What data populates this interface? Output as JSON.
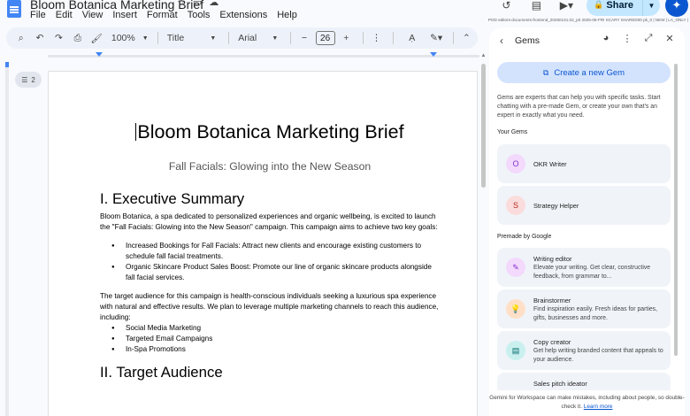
{
  "app": {
    "doc_title": "Bloom Botanica Marketing Brief",
    "menus": [
      "File",
      "Edit",
      "View",
      "Insert",
      "Format",
      "Tools",
      "Extensions",
      "Help"
    ],
    "share_label": "Share",
    "build_note": "POD editors-documents-frontend_20250131.02_p0 2025-05-FRI SCARY SHARED00 pk_0 | NEW | LA_ONLY |"
  },
  "toolbar": {
    "zoom": "100%",
    "style": "Title",
    "font": "Arial",
    "font_size": "26"
  },
  "outline": {
    "count": "2"
  },
  "document": {
    "title": "Bloom Botanica Marketing Brief",
    "subtitle": "Fall Facials: Glowing into the New Season",
    "heading1": "I. Executive Summary",
    "intro": "Bloom Botanica, a spa dedicated to personalized experiences and organic wellbeing, is excited to launch the \"Fall Facials: Glowing into the New Season\" campaign. This campaign aims to achieve two key goals:",
    "goals": [
      "Increased Bookings for Fall Facials: Attract new clients and encourage existing customers to schedule fall facial treatments.",
      "Organic Skincare Product Sales Boost:  Promote our line of organic skincare products alongside fall facial services."
    ],
    "audience_para": "The target audience for this campaign is health-conscious individuals seeking a luxurious spa experience with natural and effective results. We plan to leverage multiple marketing channels to reach this audience, including:",
    "channels": [
      "Social Media Marketing",
      "Targeted Email Campaigns",
      "In-Spa Promotions"
    ],
    "heading2": "II. Target Audience"
  },
  "gems_panel": {
    "title": "Gems",
    "create_label": "Create a new Gem",
    "description": "Gems are experts that can help you with specific tasks. Start chatting with a pre-made Gem, or create your own that's an expert in exactly what you need.",
    "your_gems_label": "Your Gems",
    "your_gems": [
      {
        "initial": "O",
        "name": "OKR Writer"
      },
      {
        "initial": "S",
        "name": "Strategy Helper"
      }
    ],
    "premade_label": "Premade by Google",
    "premade": [
      {
        "name": "Writing editor",
        "desc": "Elevate your writing. Get clear, constructive feedback, from grammar to..."
      },
      {
        "name": "Brainstormer",
        "desc": "Find inspiration easily. Fresh ideas for parties, gifts, businesses and more."
      },
      {
        "name": "Copy creator",
        "desc": "Get help writing branded content that appeals to your audience."
      },
      {
        "name": "Sales pitch ideator",
        "desc": ""
      }
    ],
    "footer_text": "Gemini for Workspace can make mistakes, including about people, so double-check it.",
    "footer_link": "Learn more"
  },
  "colors": {
    "accent": "#0b57d0",
    "share_bg": "#c2e7ff",
    "gem_o_bg": "#f3d9fb",
    "gem_s_bg": "#fbdcdc",
    "writing_bg": "#f3d9fb",
    "brainstorm_bg": "#ffe0c7",
    "copy_bg": "#c9f0ee"
  },
  "icons": {
    "back": "chevron-left-icon",
    "gem_settings": "palette-icon",
    "more": "more-vert-icon",
    "expand": "open-in-full-icon",
    "close": "close-icon"
  }
}
